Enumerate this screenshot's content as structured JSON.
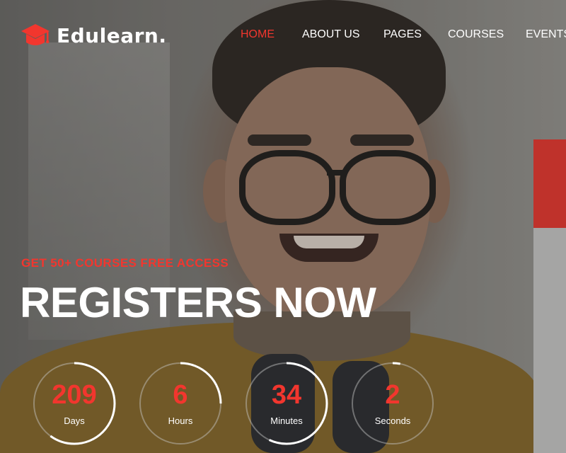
{
  "brand": {
    "name": "Edulearn.",
    "logo_icon": "graduation-cap-icon",
    "accent": "#f2362e"
  },
  "nav": {
    "items": [
      {
        "label": "HOME",
        "active": true
      },
      {
        "label": "ABOUT US",
        "active": false
      },
      {
        "label": "PAGES",
        "active": false
      },
      {
        "label": "COURSES",
        "active": false
      },
      {
        "label": "EVENTS",
        "active": false
      }
    ]
  },
  "hero": {
    "promo": "GET 50+ COURSES FREE ACCESS",
    "headline": "REGISTERS NOW"
  },
  "countdown": [
    {
      "value": "209",
      "label": "Days",
      "progress": 0.6
    },
    {
      "value": "6",
      "label": "Hours",
      "progress": 0.25
    },
    {
      "value": "34",
      "label": "Minutes",
      "progress": 0.57
    },
    {
      "value": "2",
      "label": "Seconds",
      "progress": 0.03
    }
  ]
}
